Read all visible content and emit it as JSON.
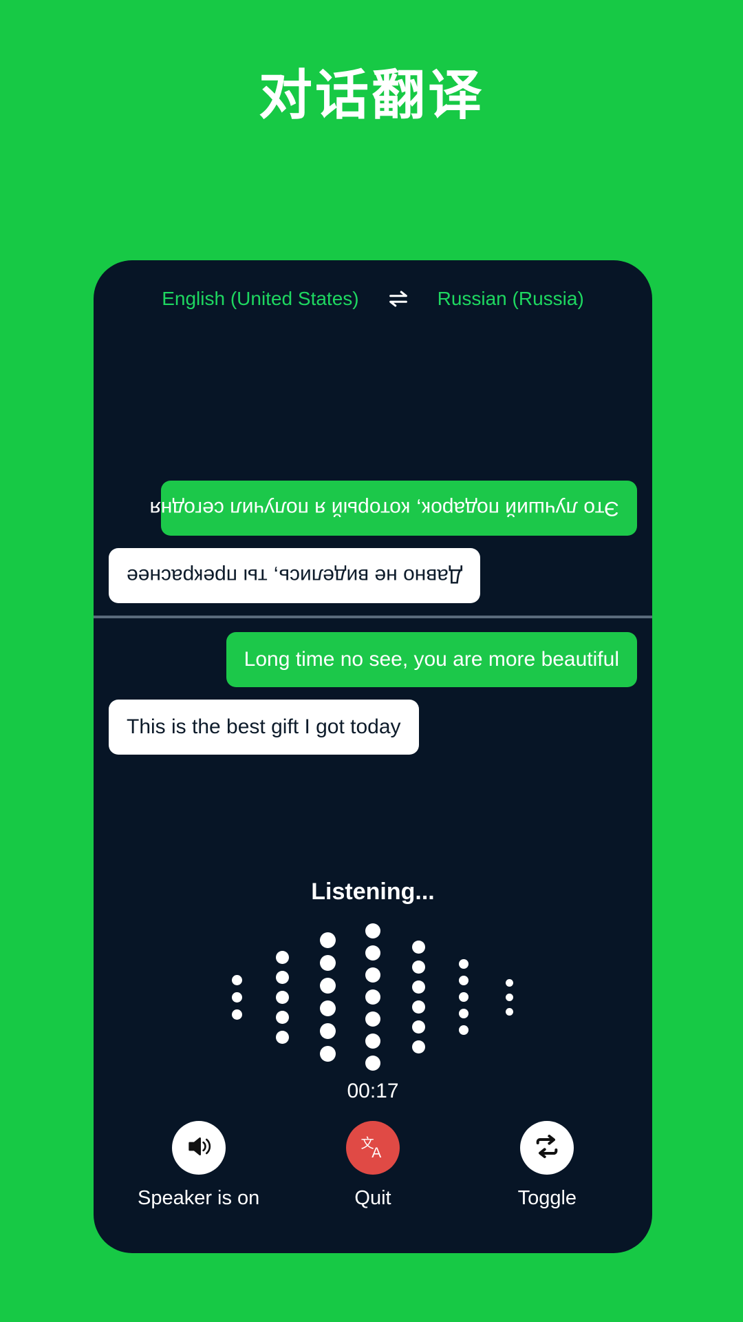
{
  "header": {
    "title": "对话翻译"
  },
  "colors": {
    "page_background": "#17C945",
    "card_background": "#071526",
    "accent_green": "#1CC84A",
    "language_label": "#1ED760",
    "quit_red": "#E04A45",
    "divider": "#5A6B7C"
  },
  "language_bar": {
    "source": "English (United States)",
    "target": "Russian (Russia)",
    "swap_icon": "swap-horizontal-icon"
  },
  "conversation": {
    "translated_pane": {
      "rotated": true,
      "messages": [
        {
          "text": "Это лучший подарок, который я получил сегодня",
          "style": "accent",
          "align": "left"
        },
        {
          "text": "Давно не виделись, ты прекраснее",
          "style": "plain",
          "align": "right"
        }
      ]
    },
    "source_pane": {
      "rotated": false,
      "messages": [
        {
          "text": "Long time no see, you are more beautiful",
          "style": "accent",
          "align": "right"
        },
        {
          "text": "This is the best gift I got today",
          "style": "plain",
          "align": "left"
        }
      ]
    }
  },
  "status": {
    "listening_label": "Listening...",
    "timer": "00:17"
  },
  "visualizer": {
    "columns": [
      {
        "dots": 3,
        "size": 15
      },
      {
        "dots": 5,
        "size": 19
      },
      {
        "dots": 6,
        "size": 23
      },
      {
        "dots": 7,
        "size": 22
      },
      {
        "dots": 6,
        "size": 19
      },
      {
        "dots": 5,
        "size": 14
      },
      {
        "dots": 3,
        "size": 11
      }
    ]
  },
  "controls": [
    {
      "label": "Speaker is on",
      "icon": "speaker-on-icon",
      "name": "speaker-button",
      "style": "light"
    },
    {
      "label": "Quit",
      "icon": "translate-icon",
      "name": "quit-button",
      "style": "danger"
    },
    {
      "label": "Toggle",
      "icon": "swap-repeat-icon",
      "name": "toggle-button",
      "style": "light"
    }
  ]
}
